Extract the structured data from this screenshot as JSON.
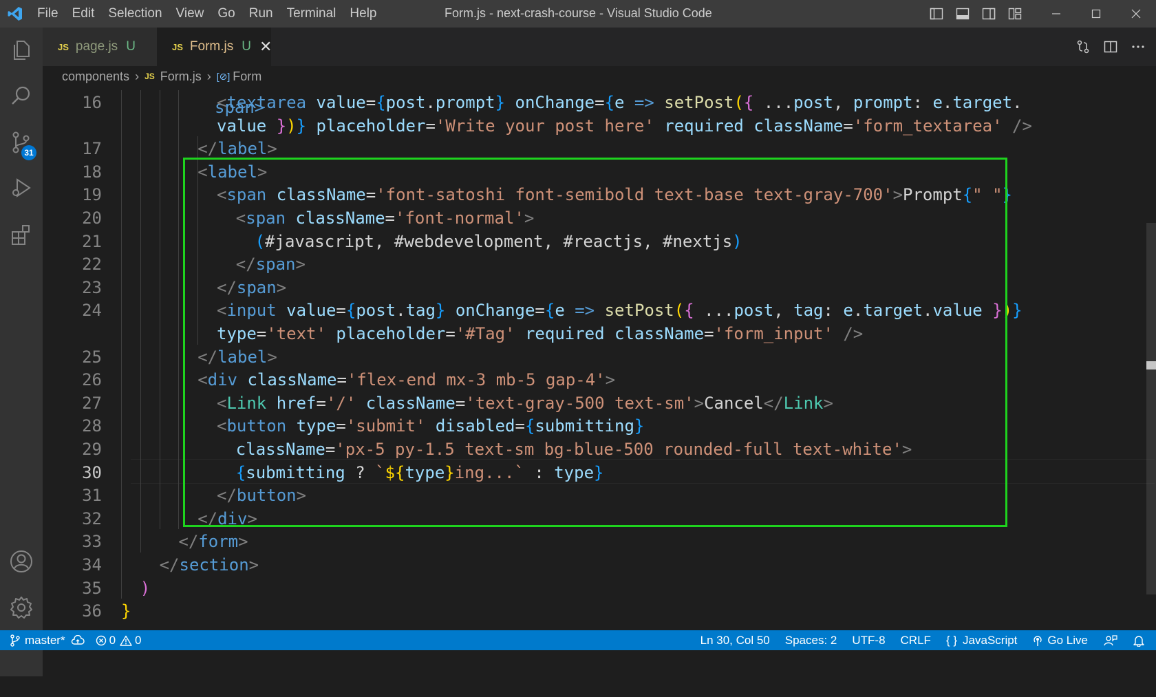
{
  "window": {
    "title": "Form.js - next-crash-course - Visual Studio Code",
    "menu": [
      "File",
      "Edit",
      "Selection",
      "View",
      "Go",
      "Run",
      "Terminal",
      "Help"
    ]
  },
  "activity_bar": {
    "items": [
      "explorer-icon",
      "search-icon",
      "source-control-icon",
      "run-debug-icon",
      "extensions-icon"
    ],
    "source_control_badge": "31",
    "bottom_items": [
      "accounts-icon",
      "settings-gear-icon"
    ]
  },
  "tabs": [
    {
      "lang": "JS",
      "label": "page.js",
      "status": "U",
      "active": false
    },
    {
      "lang": "JS",
      "label": "Form.js",
      "status": "U",
      "active": true
    }
  ],
  "breadcrumb": {
    "folder": "components",
    "file_lang": "JS",
    "file": "Form.js",
    "symbol": "Form"
  },
  "editor": {
    "current_line": "30",
    "line_numbers": [
      "16",
      "",
      "17",
      "18",
      "19",
      "20",
      "21",
      "22",
      "23",
      "24",
      "",
      "25",
      "26",
      "27",
      "28",
      "29",
      "30",
      "31",
      "32",
      "33",
      "34",
      "35",
      "36"
    ],
    "partial_top_text": "span>",
    "lines": [
      [
        [
          "t-punc",
          "<"
        ],
        [
          "t-html",
          "textarea"
        ],
        [
          "t-plain",
          " "
        ],
        [
          "t-attr",
          "value"
        ],
        [
          "t-plain",
          "="
        ],
        [
          "t-br3",
          "{"
        ],
        [
          "t-var",
          "post"
        ],
        [
          "t-plain",
          "."
        ],
        [
          "t-var",
          "prompt"
        ],
        [
          "t-br3",
          "}"
        ],
        [
          "t-plain",
          " "
        ],
        [
          "t-attr",
          "onChange"
        ],
        [
          "t-plain",
          "="
        ],
        [
          "t-br3",
          "{"
        ],
        [
          "t-var",
          "e"
        ],
        [
          "t-plain",
          " "
        ],
        [
          "t-kw",
          "=>"
        ],
        [
          "t-plain",
          " "
        ],
        [
          "t-fn",
          "setPost"
        ],
        [
          "t-br1",
          "("
        ],
        [
          "t-br2",
          "{"
        ],
        [
          "t-plain",
          " ..."
        ],
        [
          "t-var",
          "post"
        ],
        [
          "t-plain",
          ", "
        ],
        [
          "t-var",
          "prompt"
        ],
        [
          "t-plain",
          ": "
        ],
        [
          "t-var",
          "e"
        ],
        [
          "t-plain",
          "."
        ],
        [
          "t-var",
          "target"
        ],
        [
          "t-plain",
          "."
        ]
      ],
      [
        [
          "t-var",
          "value"
        ],
        [
          "t-plain",
          " "
        ],
        [
          "t-br2",
          "}"
        ],
        [
          "t-br1",
          ")"
        ],
        [
          "t-br3",
          "}"
        ],
        [
          "t-plain",
          " "
        ],
        [
          "t-attr",
          "placeholder"
        ],
        [
          "t-plain",
          "="
        ],
        [
          "t-str",
          "'Write your post here'"
        ],
        [
          "t-plain",
          " "
        ],
        [
          "t-attr",
          "required"
        ],
        [
          "t-plain",
          " "
        ],
        [
          "t-attr",
          "className"
        ],
        [
          "t-plain",
          "="
        ],
        [
          "t-str",
          "'form_textarea'"
        ],
        [
          "t-plain",
          " "
        ],
        [
          "t-punc",
          "/>"
        ]
      ],
      [
        [
          "t-punc",
          "</"
        ],
        [
          "t-html",
          "label"
        ],
        [
          "t-punc",
          ">"
        ]
      ],
      [
        [
          "t-punc",
          "<"
        ],
        [
          "t-html",
          "label"
        ],
        [
          "t-punc",
          ">"
        ]
      ],
      [
        [
          "t-punc",
          "<"
        ],
        [
          "t-html",
          "span"
        ],
        [
          "t-plain",
          " "
        ],
        [
          "t-attr",
          "className"
        ],
        [
          "t-plain",
          "="
        ],
        [
          "t-str",
          "'font-satoshi font-semibold text-base text-gray-700'"
        ],
        [
          "t-punc",
          ">"
        ],
        [
          "t-plain",
          "Prompt"
        ],
        [
          "t-br3",
          "{"
        ],
        [
          "t-str",
          "\" \""
        ],
        [
          "t-br3",
          "}"
        ]
      ],
      [
        [
          "t-punc",
          "<"
        ],
        [
          "t-html",
          "span"
        ],
        [
          "t-plain",
          " "
        ],
        [
          "t-attr",
          "className"
        ],
        [
          "t-plain",
          "="
        ],
        [
          "t-str",
          "'font-normal'"
        ],
        [
          "t-punc",
          ">"
        ]
      ],
      [
        [
          "t-br3",
          "("
        ],
        [
          "t-plain",
          "#javascript, #webdevelopment, #reactjs, #nextjs"
        ],
        [
          "t-br3",
          ")"
        ]
      ],
      [
        [
          "t-punc",
          "</"
        ],
        [
          "t-html",
          "span"
        ],
        [
          "t-punc",
          ">"
        ]
      ],
      [
        [
          "t-punc",
          "</"
        ],
        [
          "t-html",
          "span"
        ],
        [
          "t-punc",
          ">"
        ]
      ],
      [
        [
          "t-punc",
          "<"
        ],
        [
          "t-html",
          "input"
        ],
        [
          "t-plain",
          " "
        ],
        [
          "t-attr",
          "value"
        ],
        [
          "t-plain",
          "="
        ],
        [
          "t-br3",
          "{"
        ],
        [
          "t-var",
          "post"
        ],
        [
          "t-plain",
          "."
        ],
        [
          "t-var",
          "tag"
        ],
        [
          "t-br3",
          "}"
        ],
        [
          "t-plain",
          " "
        ],
        [
          "t-attr",
          "onChange"
        ],
        [
          "t-plain",
          "="
        ],
        [
          "t-br3",
          "{"
        ],
        [
          "t-var",
          "e"
        ],
        [
          "t-plain",
          " "
        ],
        [
          "t-kw",
          "=>"
        ],
        [
          "t-plain",
          " "
        ],
        [
          "t-fn",
          "setPost"
        ],
        [
          "t-br1",
          "("
        ],
        [
          "t-br2",
          "{"
        ],
        [
          "t-plain",
          " ..."
        ],
        [
          "t-var",
          "post"
        ],
        [
          "t-plain",
          ", "
        ],
        [
          "t-var",
          "tag"
        ],
        [
          "t-plain",
          ": "
        ],
        [
          "t-var",
          "e"
        ],
        [
          "t-plain",
          "."
        ],
        [
          "t-var",
          "target"
        ],
        [
          "t-plain",
          "."
        ],
        [
          "t-var",
          "value"
        ],
        [
          "t-plain",
          " "
        ],
        [
          "t-br2",
          "}"
        ],
        [
          "t-br1",
          ")"
        ],
        [
          "t-br3",
          "}"
        ]
      ],
      [
        [
          "t-attr",
          "type"
        ],
        [
          "t-plain",
          "="
        ],
        [
          "t-str",
          "'text'"
        ],
        [
          "t-plain",
          " "
        ],
        [
          "t-attr",
          "placeholder"
        ],
        [
          "t-plain",
          "="
        ],
        [
          "t-str",
          "'#Tag'"
        ],
        [
          "t-plain",
          " "
        ],
        [
          "t-attr",
          "required"
        ],
        [
          "t-plain",
          " "
        ],
        [
          "t-attr",
          "className"
        ],
        [
          "t-plain",
          "="
        ],
        [
          "t-str",
          "'form_input'"
        ],
        [
          "t-plain",
          " "
        ],
        [
          "t-punc",
          "/>"
        ]
      ],
      [
        [
          "t-punc",
          "</"
        ],
        [
          "t-html",
          "label"
        ],
        [
          "t-punc",
          ">"
        ]
      ],
      [
        [
          "t-punc",
          "<"
        ],
        [
          "t-html",
          "div"
        ],
        [
          "t-plain",
          " "
        ],
        [
          "t-attr",
          "className"
        ],
        [
          "t-plain",
          "="
        ],
        [
          "t-str",
          "'flex-end mx-3 mb-5 gap-4'"
        ],
        [
          "t-punc",
          ">"
        ]
      ],
      [
        [
          "t-punc",
          "<"
        ],
        [
          "t-tag",
          "Link"
        ],
        [
          "t-plain",
          " "
        ],
        [
          "t-attr",
          "href"
        ],
        [
          "t-plain",
          "="
        ],
        [
          "t-str",
          "'/'"
        ],
        [
          "t-plain",
          " "
        ],
        [
          "t-attr",
          "className"
        ],
        [
          "t-plain",
          "="
        ],
        [
          "t-str",
          "'text-gray-500 text-sm'"
        ],
        [
          "t-punc",
          ">"
        ],
        [
          "t-plain",
          "Cancel"
        ],
        [
          "t-punc",
          "</"
        ],
        [
          "t-tag",
          "Link"
        ],
        [
          "t-punc",
          ">"
        ]
      ],
      [
        [
          "t-punc",
          "<"
        ],
        [
          "t-html",
          "button"
        ],
        [
          "t-plain",
          " "
        ],
        [
          "t-attr",
          "type"
        ],
        [
          "t-plain",
          "="
        ],
        [
          "t-str",
          "'submit'"
        ],
        [
          "t-plain",
          " "
        ],
        [
          "t-attr",
          "disabled"
        ],
        [
          "t-plain",
          "="
        ],
        [
          "t-br3",
          "{"
        ],
        [
          "t-var",
          "submitting"
        ],
        [
          "t-br3",
          "}"
        ]
      ],
      [
        [
          "t-attr",
          "className"
        ],
        [
          "t-plain",
          "="
        ],
        [
          "t-str",
          "'px-5 py-1.5 text-sm bg-blue-500 rounded-full text-white'"
        ],
        [
          "t-punc",
          ">"
        ]
      ],
      [
        [
          "t-br3",
          "{"
        ],
        [
          "t-var",
          "submitting"
        ],
        [
          "t-plain",
          " ? "
        ],
        [
          "t-tpl",
          "`"
        ],
        [
          "t-br1",
          "${"
        ],
        [
          "t-var",
          "type"
        ],
        [
          "t-br1",
          "}"
        ],
        [
          "t-tpl",
          "ing...`"
        ],
        [
          "t-plain",
          " : "
        ],
        [
          "t-var",
          "type"
        ],
        [
          "t-br3",
          "}"
        ]
      ],
      [
        [
          "t-punc",
          "</"
        ],
        [
          "t-html",
          "button"
        ],
        [
          "t-punc",
          ">"
        ]
      ],
      [
        [
          "t-punc",
          "</"
        ],
        [
          "t-html",
          "div"
        ],
        [
          "t-punc",
          ">"
        ]
      ],
      [
        [
          "t-punc",
          "</"
        ],
        [
          "t-html",
          "form"
        ],
        [
          "t-punc",
          ">"
        ]
      ],
      [
        [
          "t-punc",
          "</"
        ],
        [
          "t-html",
          "section"
        ],
        [
          "t-punc",
          ">"
        ]
      ],
      [
        [
          "t-br2",
          ")"
        ]
      ],
      [
        [
          "t-br1",
          "}"
        ]
      ]
    ]
  },
  "status_bar": {
    "branch": "master*",
    "errors": "0",
    "warnings": "0",
    "cursor": "Ln 30, Col 50",
    "indent": "Spaces: 2",
    "encoding": "UTF-8",
    "eol": "CRLF",
    "language": "JavaScript",
    "go_live": "Go Live"
  },
  "colors": {
    "highlight_box": "#1ed31e",
    "status_bar": "#007acc",
    "activity_bar": "#333333",
    "editor_bg": "#1e1e1e"
  }
}
